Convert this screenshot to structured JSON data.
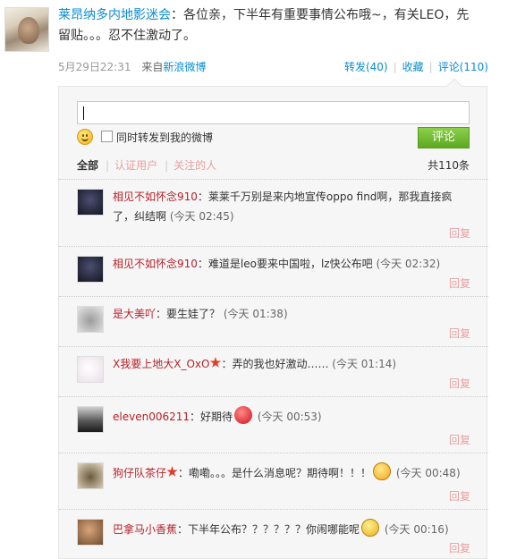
{
  "post": {
    "author": "莱昂纳多内地影迷会",
    "text": "：各位亲，下半年有重要事情公布哦~，有关LEO，先留贴。。。忍不住激动了。",
    "date": "5月29日22:31",
    "source_prefix": "来自",
    "source": "新浪微博",
    "actions": {
      "forward": "转发(40)",
      "favorite": "收藏",
      "comment": "评论(110)"
    }
  },
  "comment_form": {
    "input_value": "",
    "forward_label": "同时转发到我的微博",
    "submit_label": "评论"
  },
  "filters": {
    "all": "全部",
    "verified": "认证用户",
    "following": "关注的人",
    "total": "共110条"
  },
  "comments": [
    {
      "name": "相见不如怀念910",
      "text": "：莱莱千万别是来内地宣传oppo find啊，那我直接疯了，纠结啊",
      "time": "(今天 02:45)",
      "reply": "回复",
      "avatar": "av-dark",
      "emoji": ""
    },
    {
      "name": "相见不如怀念910",
      "text": "：难道是leo要来中国啦，lz快公布吧",
      "time": "(今天 02:32)",
      "reply": "回复",
      "avatar": "av-dark",
      "emoji": ""
    },
    {
      "name": "是大美吖",
      "text": "：要生娃了？",
      "time": "(今天 01:38)",
      "reply": "回复",
      "avatar": "av-cat",
      "emoji": ""
    },
    {
      "name": "X我要上地大X_OxO",
      "text": "：弄的我也好激动……",
      "time": "(今天 01:14)",
      "reply": "回复",
      "avatar": "av-light",
      "emoji": "",
      "star": true
    },
    {
      "name": "eleven006211",
      "text": "：好期待",
      "time": "(今天 00:53)",
      "reply": "回复",
      "avatar": "av-silh",
      "emoji": "heart"
    },
    {
      "name": "狗仔队茶仔",
      "text": "：嘞嘞。。。是什么消息呢？期待啊！！！",
      "time": "(今天 00:48)",
      "reply": "回复",
      "avatar": "av-hedge",
      "emoji": "surprised",
      "star": true
    },
    {
      "name": "巴拿马小香蕉",
      "text": "：下半年公布？？？？？？你闹哪能呢",
      "time": "(今天 00:16)",
      "reply": "回复",
      "avatar": "av-girl",
      "emoji": "cry"
    }
  ],
  "icons": {
    "smiley": "smiley-icon",
    "heart": "heart-emoji-icon",
    "surprised": "surprised-emoji-icon",
    "cry": "crying-emoji-icon",
    "star": "star-badge-icon"
  },
  "colors": {
    "link": "#0a8cd2",
    "username": "#b5222a",
    "reply": "#e7a0a0",
    "submit_green": "#6cba2d"
  }
}
